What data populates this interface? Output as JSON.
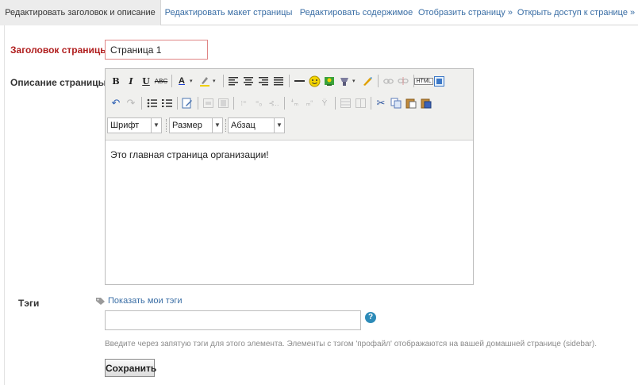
{
  "tabs": [
    {
      "label": "Редактировать заголовок и описание",
      "active": true
    },
    {
      "label": "Редактировать макет страницы",
      "active": false
    },
    {
      "label": "Редактировать содержимое",
      "active": false
    },
    {
      "label": "Отобразить страницу »",
      "active": false
    },
    {
      "label": "Открыть доступ к странице »",
      "active": false
    }
  ],
  "form": {
    "title_label": "Заголовок страницы",
    "required_mark": "*",
    "title_value": "Страница 1",
    "description_label": "Описание страницы",
    "tags_label": "Тэги",
    "show_tags_link": "Показать мои тэги",
    "tags_value": "",
    "help_glyph": "?",
    "tags_hint": "Введите через запятую тэги для этого элемента. Элементы с тэгом 'профайл' отображаются на вашей домашней странице (sidebar).",
    "save_label": "Сохранить"
  },
  "editor": {
    "font_select": "Шрифт",
    "size_select": "Размер",
    "format_select": "Абзац",
    "content": "Это главная страница организации!",
    "toolbar_icons_row1": [
      "bold-icon",
      "italic-icon",
      "underline-icon",
      "strikethrough-icon",
      "text-color-icon",
      "highlight-color-icon",
      "align-left-icon",
      "align-center-icon",
      "align-right-icon",
      "justify-icon",
      "horizontal-rule-icon",
      "emoticon-icon",
      "image-icon",
      "cleanup-icon",
      "spellcheck-icon",
      "link-icon",
      "unlink-icon",
      "html-source-icon",
      "fullscreen-icon"
    ],
    "toolbar_icons_row2": [
      "undo-icon",
      "redo-icon",
      "bullet-list-icon",
      "numbered-list-icon",
      "edit-icon",
      "outdent-icon",
      "indent-icon",
      "table-insert-icon",
      "table-row-icon",
      "table-col-icon",
      "split-cell-icon",
      "merge-cell-icon",
      "delete-table-icon",
      "table-props-icon",
      "cell-props-icon",
      "cut-icon",
      "copy-icon",
      "paste-icon",
      "paste-word-icon"
    ]
  },
  "colors": {
    "link": "#3a6ea5",
    "required": "#b01e1e",
    "help": "#2d8bb8"
  }
}
